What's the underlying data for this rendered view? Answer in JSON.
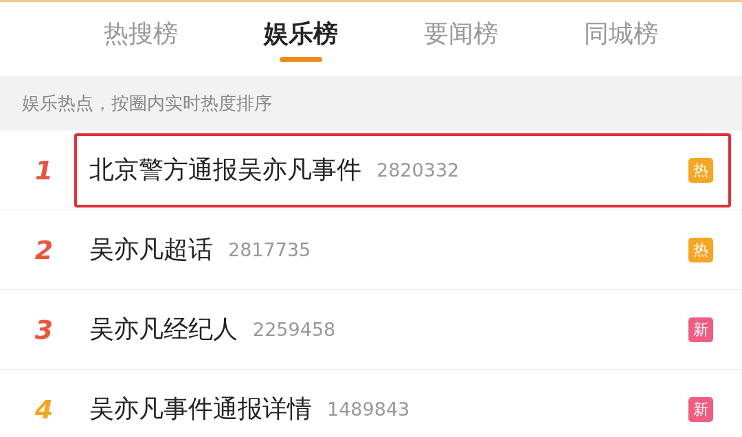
{
  "tabs": [
    {
      "label": "热搜榜",
      "selected": false
    },
    {
      "label": "娱乐榜",
      "selected": true
    },
    {
      "label": "要闻榜",
      "selected": false
    },
    {
      "label": "同城榜",
      "selected": false
    }
  ],
  "subtitle": "娱乐热点，按圈内实时热度排序",
  "items": [
    {
      "rank": "1",
      "color": "#e9553f",
      "title": "北京警方通报吴亦凡事件",
      "count": "2820332",
      "badge": {
        "kind": "hot",
        "text": "热"
      },
      "highlighted": true
    },
    {
      "rank": "2",
      "color": "#e9553f",
      "title": "吴亦凡超话",
      "count": "2817735",
      "badge": {
        "kind": "hot",
        "text": "热"
      },
      "highlighted": false
    },
    {
      "rank": "3",
      "color": "#e9553f",
      "title": "吴亦凡经纪人",
      "count": "2259458",
      "badge": {
        "kind": "new",
        "text": "新"
      },
      "highlighted": false
    },
    {
      "rank": "4",
      "color": "#f5a623",
      "title": "吴亦凡事件通报详情",
      "count": "1489843",
      "badge": {
        "kind": "new",
        "text": "新"
      },
      "highlighted": false
    }
  ]
}
